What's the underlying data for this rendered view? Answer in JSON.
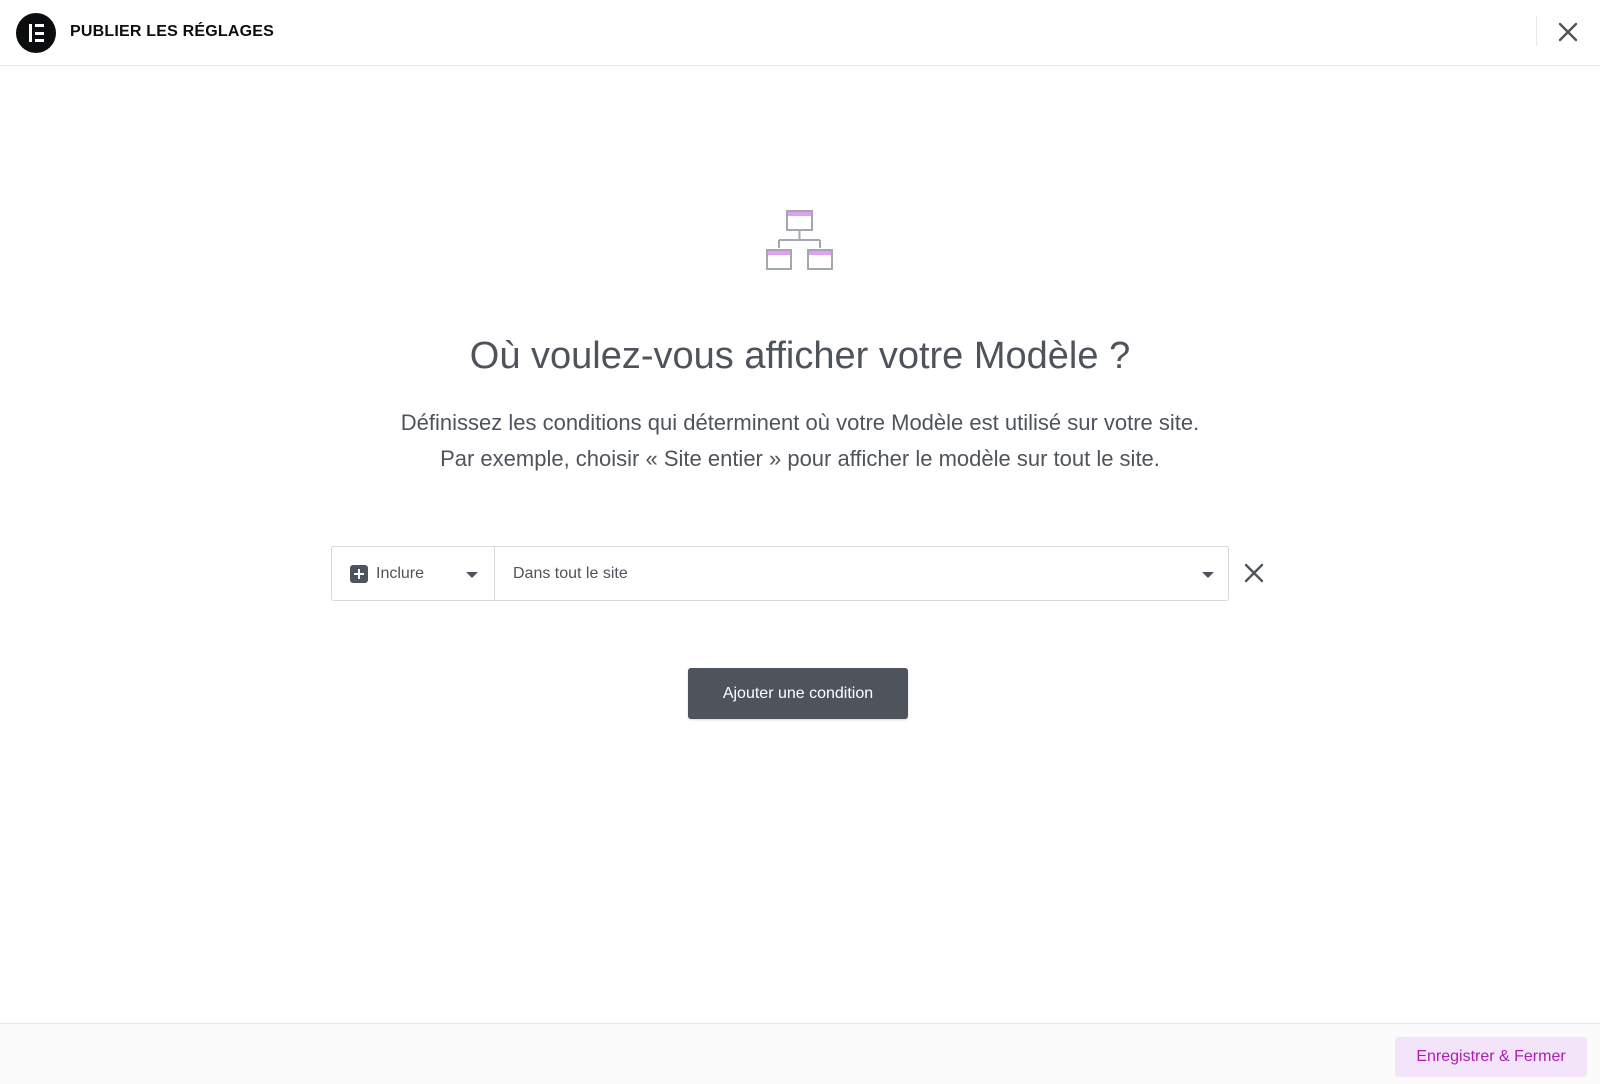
{
  "header": {
    "title": "PUBLIER LES RÉGLAGES",
    "logo_icon": "elementor-logo-icon",
    "close_icon": "close-icon"
  },
  "hero": {
    "icon": "sitemap-icon",
    "title": "Où voulez-vous afficher votre Modèle ?",
    "description_line1": "Définissez les conditions qui déterminent où votre Modèle est utilisé sur votre site.",
    "description_line2": "Par exemple, choisir « Site entier » pour afficher le modèle sur tout le site."
  },
  "condition": {
    "type_label": "Inclure",
    "scope_label": "Dans tout le site",
    "remove_icon": "close-icon"
  },
  "actions": {
    "add_condition_label": "Ajouter une condition",
    "save_close_label": "Enregistrer & Fermer"
  },
  "colors": {
    "text": "#4f545c",
    "brand_accent": "#b01bb5",
    "accent_bg": "#f3e4f9",
    "icon_highlight": "#e39ef5"
  }
}
